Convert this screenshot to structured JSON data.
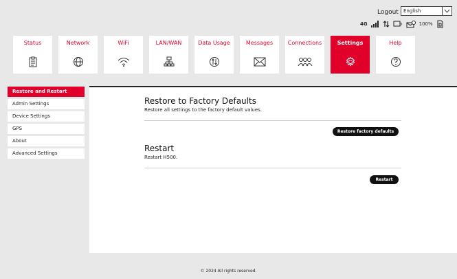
{
  "header": {
    "logout_label": "Logout",
    "language_selected": "English",
    "status": {
      "network_type": "4G",
      "battery_percent": "100%"
    }
  },
  "nav": {
    "items": [
      {
        "label": "Status",
        "icon": "clipboard-icon"
      },
      {
        "label": "Network",
        "icon": "globe-icon"
      },
      {
        "label": "WiFi",
        "icon": "wifi-icon"
      },
      {
        "label": "LAN/WAN",
        "icon": "network-tree-icon"
      },
      {
        "label": "Data Usage",
        "icon": "data-usage-icon"
      },
      {
        "label": "Messages",
        "icon": "envelope-icon"
      },
      {
        "label": "Connections",
        "icon": "users-icon"
      },
      {
        "label": "Settings",
        "icon": "gear-icon",
        "active": true
      },
      {
        "label": "Help",
        "icon": "question-icon"
      }
    ]
  },
  "sidebar": {
    "items": [
      {
        "label": "Restore and Restart",
        "active": true
      },
      {
        "label": "Admin Settings"
      },
      {
        "label": "Device Settings"
      },
      {
        "label": "GPS"
      },
      {
        "label": "About"
      },
      {
        "label": "Advanced Settings"
      }
    ]
  },
  "main": {
    "restore": {
      "title": "Restore to Factory Defaults",
      "description": "Restore all settings to the factory default values.",
      "button_label": "Restore factory defaults"
    },
    "restart": {
      "title": "Restart",
      "description": "Restart H500.",
      "button_label": "Restart"
    }
  },
  "footer": {
    "copyright": "© 2024 All rights reserved."
  },
  "colors": {
    "accent": "#e0002a",
    "background": "#e8e8e8",
    "button": "#111111"
  }
}
